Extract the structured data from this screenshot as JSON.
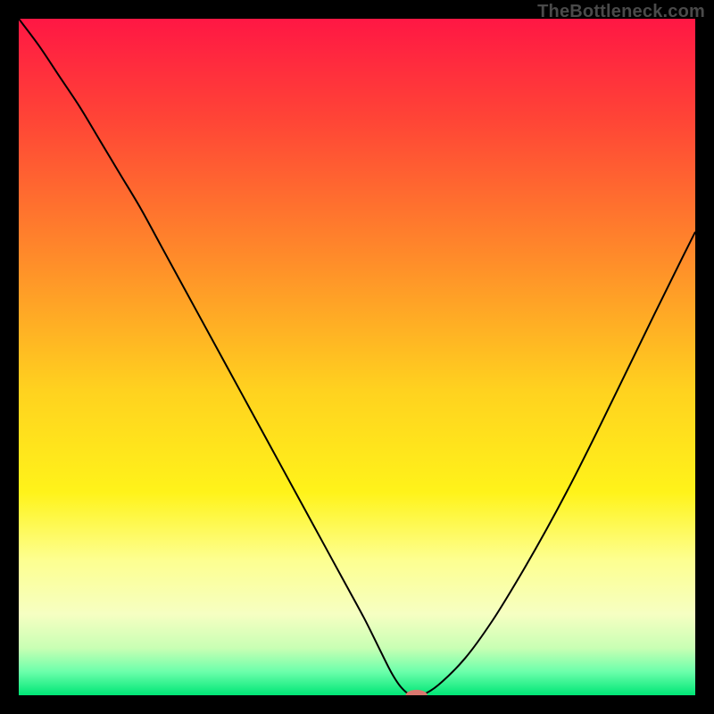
{
  "watermark": "TheBottleneck.com",
  "chart_data": {
    "type": "line",
    "title": "",
    "xlabel": "",
    "ylabel": "",
    "xlim": [
      0,
      100
    ],
    "ylim": [
      0,
      100
    ],
    "grid": false,
    "legend": false,
    "background": {
      "type": "vertical-gradient",
      "stops": [
        {
          "offset": 0.0,
          "color": "#ff1744"
        },
        {
          "offset": 0.15,
          "color": "#ff4536"
        },
        {
          "offset": 0.35,
          "color": "#ff8a2a"
        },
        {
          "offset": 0.55,
          "color": "#ffd21f"
        },
        {
          "offset": 0.7,
          "color": "#fff31a"
        },
        {
          "offset": 0.8,
          "color": "#fdff90"
        },
        {
          "offset": 0.88,
          "color": "#f6ffc2"
        },
        {
          "offset": 0.93,
          "color": "#c9ffb4"
        },
        {
          "offset": 0.965,
          "color": "#6cffab"
        },
        {
          "offset": 1.0,
          "color": "#00e676"
        }
      ]
    },
    "series": [
      {
        "name": "bottleneck-curve",
        "color": "#000000",
        "width": 2,
        "x": [
          0.0,
          3.0,
          6.0,
          9.0,
          12.0,
          15.0,
          18.0,
          21.0,
          24.0,
          27.0,
          30.0,
          33.0,
          36.0,
          39.0,
          42.0,
          45.0,
          48.0,
          51.0,
          53.0,
          55.0,
          56.5,
          58.0,
          59.5,
          62.0,
          66.0,
          70.0,
          74.0,
          78.0,
          82.0,
          86.0,
          90.0,
          94.0,
          98.0,
          100.0
        ],
        "y": [
          100.0,
          96.0,
          91.5,
          87.0,
          82.0,
          77.0,
          72.0,
          66.5,
          61.0,
          55.5,
          50.0,
          44.5,
          39.0,
          33.5,
          28.0,
          22.5,
          17.0,
          11.5,
          7.5,
          3.5,
          1.2,
          0.0,
          0.0,
          1.5,
          5.5,
          11.0,
          17.5,
          24.5,
          32.0,
          40.0,
          48.2,
          56.4,
          64.5,
          68.5
        ]
      }
    ],
    "marker": {
      "name": "optimal-point",
      "x": 58.8,
      "y": 0.0,
      "color": "#d9776f",
      "rx": 1.6,
      "ry": 0.8
    }
  }
}
